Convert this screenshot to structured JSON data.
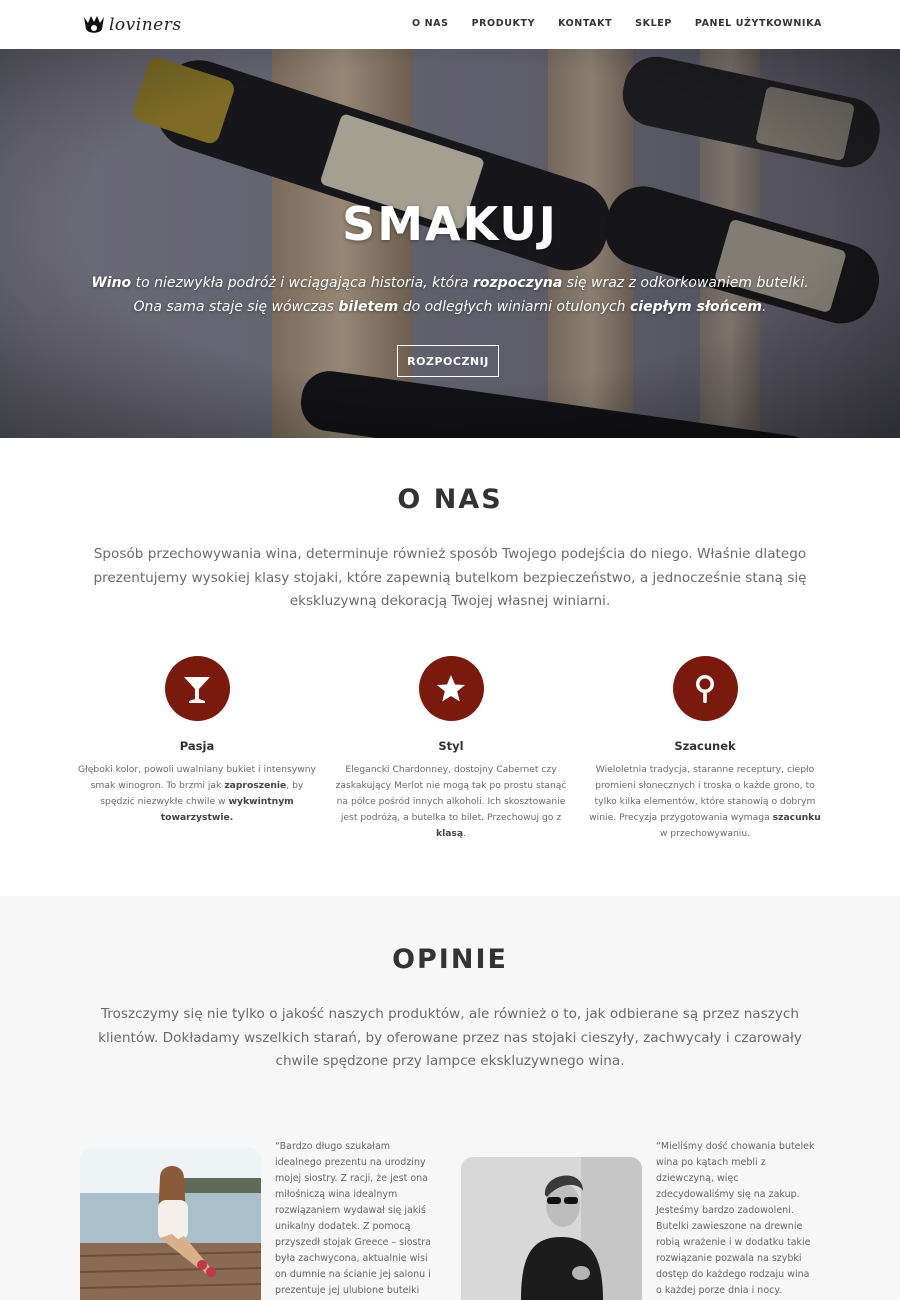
{
  "nav": {
    "logo_text": "loviners",
    "menu": [
      "O NAS",
      "PRODUKTY",
      "KONTAKT",
      "SKLEP",
      "PANEL UŻYTKOWNIKA"
    ]
  },
  "hero": {
    "title": "SMAKUJ",
    "line1": {
      "b1": "Wino",
      "t1": " to niezwykła podróż i wciągająca historia, która ",
      "b2": "rozpoczyna",
      "t2": " się wraz z odkorkowaniem butelki."
    },
    "line2": {
      "t1": "Ona sama staje się wówczas ",
      "b1": "biletem",
      "t2": " do odległych winiarni otulonych ",
      "b2": "ciepłym słońcem",
      "t3": "."
    },
    "button": "ROZPOCZNIJ"
  },
  "about": {
    "title": "O NAS",
    "intro": "Sposób przechowywania wina, determinuje również sposób Twojego podejścia do niego. Właśnie dlatego prezentujemy wysokiej klasy stojaki, które zapewnią butelkom bezpieczeństwo, a jednocześnie staną się ekskluzywną dekoracją Twojej własnej winiarni.",
    "features": [
      {
        "icon": "cocktail-glass-icon",
        "title": "Pasja",
        "t1": "Głęboki kolor, powoli uwalniany bukiet i intensywny smak winogron. To brzmi jak ",
        "b1": "zaproszenie",
        "t2": ", by spędzić niezwykłe chwile w ",
        "b2": "wykwintnym towarzystwie.",
        "t3": ""
      },
      {
        "icon": "star-icon",
        "title": "Styl",
        "t1": "Elegancki Chardonney, dostojny Cabernet czy zaskakujący Merlot nie mogą tak po prostu stanąć na półce pośród innych alkoholi. Ich skosztowanie jest podróżą, a butelka to bilet. Przechowuj go z ",
        "b1": "klasą",
        "t2": ".",
        "b2": "",
        "t3": ""
      },
      {
        "icon": "lollipop-icon",
        "title": "Szacunek",
        "t1": "Wieloletnia tradycja, staranne receptury, ciepło promieni słonecznych i troska o każde grono, to tylko kilka elementów, które stanowią o dobrym winie. Precyzja przygotowania wymaga ",
        "b1": "szacunku",
        "t2": " w przechowywaniu.",
        "b2": "",
        "t3": ""
      }
    ]
  },
  "reviews": {
    "title": "OPINIE",
    "intro": "Troszczymy się nie tylko o jakość naszych produktów, ale również o to, jak odbierane są przez naszych klientów. Dokładamy wszelkich starań, by oferowane przez nas stojaki cieszyły, zachwycały i czarowały chwile spędzone przy lampce ekskluzywnego wina.",
    "items": [
      {
        "quote": "“Bardzo długo szukałam idealnego prezentu na urodziny mojej siostry. Z racji, że jest ona miłośniczą wina idealnym rozwiązaniem wydawał się jakiś unikalny dodatek. Z pomocą przyszedł stojak Greece – siostra była zachwycona, aktualnie wisi on dumnie na ścianie jej salonu i prezentuje jej ulubione butelki"
      },
      {
        "quote": "“Mieliśmy dość chowania butelek wina po kątach mebli z dziewczyną, więc zdecydowaliśmy się na zakup. Jesteśmy bardzo zadowoleni. Butelki zawieszone na drewnie robią wrażenie i w dodatku takie rozwiązanie pozwala na szybki dostęp do każdego rodzaju wina o każdej porze dnia i nocy. Polecam"
      }
    ]
  },
  "colors": {
    "accent": "#7a1a0e",
    "heading": "#333333",
    "body_text": "#6b6b6b",
    "section_bg": "#f6f7f6"
  }
}
